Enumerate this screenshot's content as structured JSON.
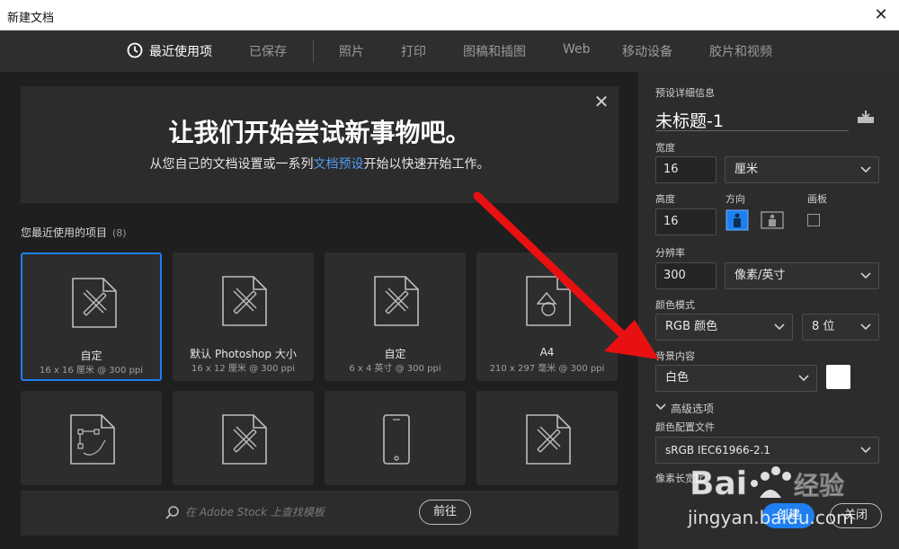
{
  "window": {
    "title": "新建文档",
    "close_glyph": "✕"
  },
  "tabs": [
    {
      "label": "最近使用项",
      "active": true
    },
    {
      "label": "已保存"
    },
    {
      "label": "照片"
    },
    {
      "label": "打印"
    },
    {
      "label": "图稿和插图"
    },
    {
      "label": "Web"
    },
    {
      "label": "移动设备"
    },
    {
      "label": "胶片和视频"
    }
  ],
  "hero": {
    "title": "让我们开始尝试新事物吧。",
    "sub_before": "从您自己的文档设置或一系列",
    "sub_link": "文档预设",
    "sub_after": "开始以快速开始工作。",
    "close_glyph": "✕"
  },
  "recent": {
    "title": "您最近使用的项目",
    "count": "(8)",
    "items": [
      {
        "name": "自定",
        "dims": "16 x 16 厘米 @ 300 ppi",
        "icon": "document-icon"
      },
      {
        "name": "默认 Photoshop 大小",
        "dims": "16 x 12 厘米 @ 300 ppi",
        "icon": "document-icon"
      },
      {
        "name": "自定",
        "dims": "6 x 4 英寸 @ 300 ppi",
        "icon": "document-icon"
      },
      {
        "name": "A4",
        "dims": "210 x 297 毫米 @ 300 ppi",
        "icon": "print-document-icon"
      },
      {
        "name": "",
        "dims": "",
        "icon": "illustration-icon"
      },
      {
        "name": "",
        "dims": "",
        "icon": "document-icon"
      },
      {
        "name": "",
        "dims": "",
        "icon": "mobile-device-icon"
      },
      {
        "name": "",
        "dims": "",
        "icon": "document-icon"
      }
    ]
  },
  "stock": {
    "placeholder": "在 Adobe Stock 上查找模板",
    "go_label": "前往"
  },
  "details": {
    "section_title": "预设详细信息",
    "doc_title": "未标题-1",
    "width_label": "宽度",
    "width_value": "16",
    "width_unit": "厘米",
    "height_label": "高度",
    "height_value": "16",
    "orientation_label": "方向",
    "artboard_label": "画板",
    "resolution_label": "分辨率",
    "resolution_value": "300",
    "resolution_unit": "像素/英寸",
    "color_mode_label": "颜色模式",
    "color_mode_value": "RGB 颜色",
    "bit_depth_value": "8 位",
    "background_label": "背景内容",
    "background_value": "白色",
    "advanced_label": "高级选项",
    "color_profile_label": "颜色配置文件",
    "color_profile_value": "sRGB IEC61966-2.1",
    "pixel_aspect_label": "像素长宽比"
  },
  "actions": {
    "create_label": "创建",
    "close_label": "关闭"
  },
  "watermark": {
    "text": "jingyan.baidu.com"
  },
  "colors": {
    "accent": "#1e7ff0",
    "arrow": "#e81010",
    "panel": "#2c2c2c",
    "bg": "#1f1f1f"
  }
}
